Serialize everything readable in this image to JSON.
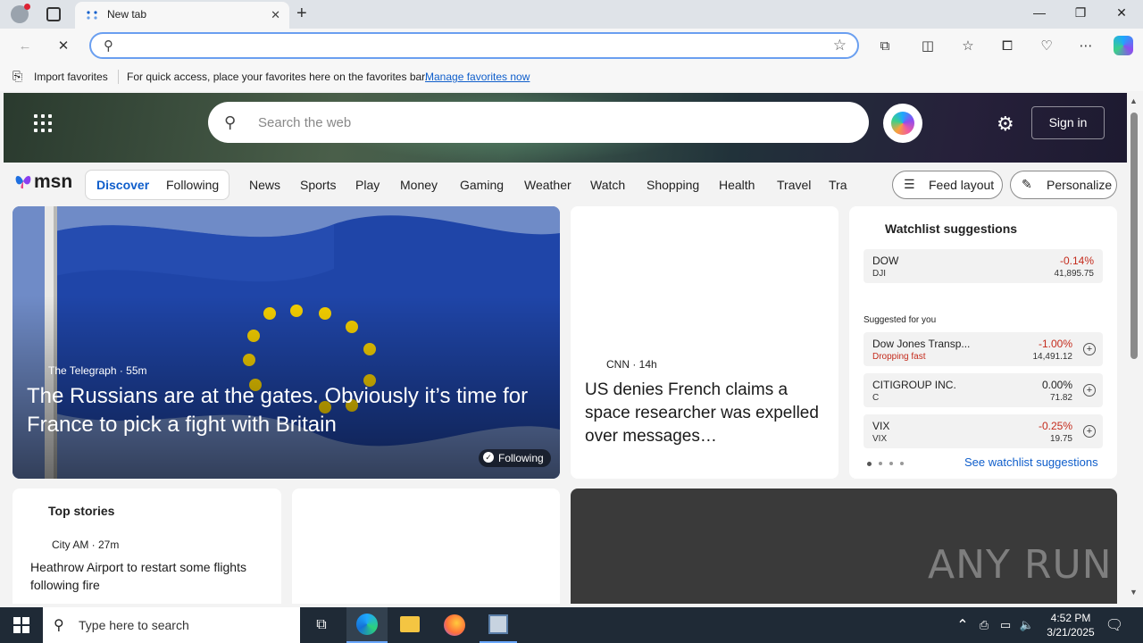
{
  "browser": {
    "tab_title": "New tab",
    "address_value": "",
    "favorites_bar": {
      "import_label": "Import favorites",
      "message": "For quick access, place your favorites here on the favorites bar.",
      "manage_link": "Manage favorites now"
    }
  },
  "msn": {
    "search_placeholder": "Search the web",
    "sign_in": "Sign in",
    "logo_text": "msn",
    "nav_tabs": {
      "discover": "Discover",
      "following": "Following"
    },
    "nav_links": [
      "News",
      "Sports",
      "Play",
      "Money",
      "Gaming",
      "Weather",
      "Watch",
      "Shopping",
      "Health",
      "Travel",
      "Tra"
    ],
    "feed_layout": "Feed layout",
    "personalize": "Personalize"
  },
  "hero_story": {
    "source": "The Telegraph",
    "age": "55m",
    "source_line": "The Telegraph · 55m",
    "headline": "The Russians are at the gates. Obviously it’s time for France to pick a fight with Britain",
    "following_badge": "Following"
  },
  "cnn_story": {
    "source_line": "CNN · 14h",
    "headline": "US denies French claims a space researcher was expelled over messages…"
  },
  "watchlist": {
    "title": "Watchlist suggestions",
    "suggested_label": "Suggested for you",
    "see_link": "See watchlist suggestions",
    "items": [
      {
        "name": "DOW",
        "ticker": "DJI",
        "change": "-0.14%",
        "price": "41,895.75"
      },
      {
        "name": "Dow Jones Transp...",
        "ticker": "Dropping fast",
        "change": "-1.00%",
        "price": "14,491.12"
      },
      {
        "name": "CITIGROUP INC.",
        "ticker": "C",
        "change": "0.00%",
        "price": "71.82"
      },
      {
        "name": "VIX",
        "ticker": "VIX",
        "change": "-0.25%",
        "price": "19.75"
      }
    ]
  },
  "top_stories": {
    "title": "Top stories",
    "source_line": "City AM · 27m",
    "headline": "Heathrow Airport to restart some flights following fire"
  },
  "watermark": "ANY RUN",
  "taskbar": {
    "search_placeholder": "Type here to search",
    "time": "4:52 PM",
    "date": "3/21/2025"
  },
  "colors": {
    "accent": "#0f5ecb",
    "negative": "#c42b1c",
    "taskbar": "#1f2a36"
  }
}
